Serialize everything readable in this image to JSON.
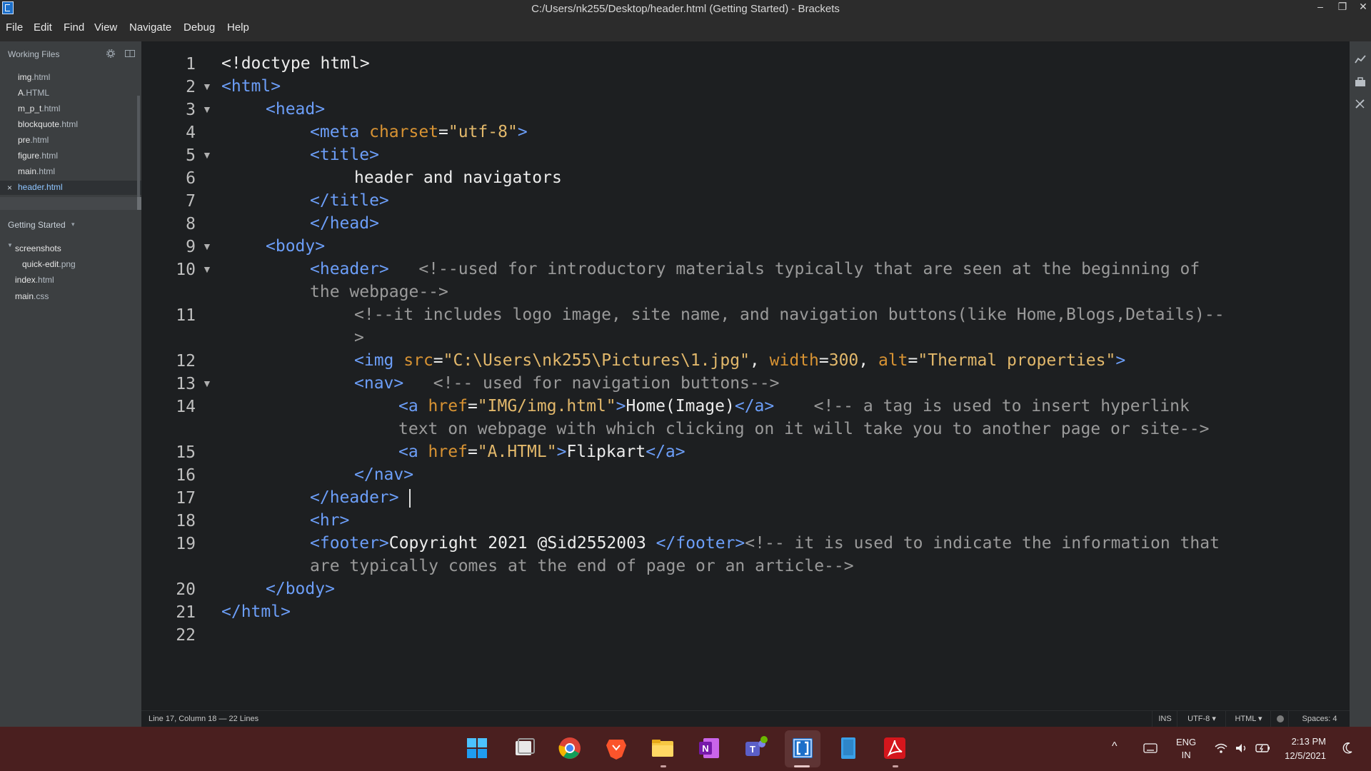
{
  "window": {
    "title": "C:/Users/nk255/Desktop/header.html (Getting Started) - Brackets",
    "minimize_glyph": "–",
    "restore_glyph": "❐",
    "close_glyph": "✕"
  },
  "menu": [
    "File",
    "Edit",
    "Find",
    "View",
    "Navigate",
    "Debug",
    "Help"
  ],
  "sidebar": {
    "working_files_title": "Working Files",
    "working_files": [
      {
        "name": "img",
        "ext": ".html"
      },
      {
        "name": "A",
        "ext": ".HTML"
      },
      {
        "name": "m_p_t",
        "ext": ".html"
      },
      {
        "name": "blockquote",
        "ext": ".html"
      },
      {
        "name": "pre",
        "ext": ".html"
      },
      {
        "name": "figure",
        "ext": ".html"
      },
      {
        "name": "main",
        "ext": ".html"
      },
      {
        "name": "header",
        "ext": ".html",
        "active": true
      }
    ],
    "close_glyph": "×",
    "project_title": "Getting Started",
    "project_caret": "▾",
    "tree": [
      {
        "name": "screenshots",
        "ext": "",
        "type": "folder"
      },
      {
        "name": "quick-edit",
        "ext": ".png",
        "type": "file"
      },
      {
        "name": "index",
        "ext": ".html",
        "type": "file"
      },
      {
        "name": "main",
        "ext": ".css",
        "type": "file"
      }
    ]
  },
  "editor": {
    "line_numbers": [
      "1",
      "2",
      "3",
      "4",
      "5",
      "6",
      "7",
      "8",
      "9",
      "10",
      "11",
      "12",
      "13",
      "14",
      "15",
      "16",
      "17",
      "18",
      "19",
      "20",
      "21",
      "22"
    ],
    "fold_marker": "▼",
    "lines": {
      "l1": {
        "tag1": "<!doctype html>"
      },
      "l2": {
        "tag1": "<html>"
      },
      "l3": {
        "tag1": "<head>"
      },
      "l4": {
        "tag1": "<meta ",
        "attr1": "charset",
        "eq": "=",
        "val1": "\"utf-8\"",
        "tag2": ">"
      },
      "l5": {
        "tag1": "<title>"
      },
      "l6": {
        "text": "header and navigators"
      },
      "l7": {
        "tag1": "</title>"
      },
      "l8": {
        "tag1": "</head>"
      },
      "l9": {
        "tag1": "<body>"
      },
      "l10": {
        "tag1": "<header>",
        "comment": "<!--used for introductory materials typically that are seen at the beginning of",
        "comment_cont": "the webpage-->"
      },
      "l11": {
        "comment": "<!--it includes logo image, site name, and navigation buttons(like Home,Blogs,Details)--",
        "comment_cont": ">"
      },
      "l12": {
        "tag1": "<img ",
        "attr1": "src",
        "eq1": "=",
        "val1": "\"C:\\Users\\nk255\\Pictures\\1.jpg\"",
        "sep1": ", ",
        "attr2": "width",
        "eq2": "=",
        "val2": "300",
        "sep2": ", ",
        "attr3": "alt",
        "eq3": "=",
        "val3": "\"Thermal properties\"",
        "tag2": ">"
      },
      "l13": {
        "tag1": "<nav>",
        "comment": "<!-- used for navigation buttons-->"
      },
      "l14": {
        "tag1": "<a ",
        "attr1": "href",
        "eq": "=",
        "val1": "\"IMG/img.html\"",
        "tag2": ">",
        "text": "Home(Image)",
        "tag3": "</a>",
        "comment": "<!-- a tag is used to insert hyperlink",
        "comment_cont": "text on webpage with which clicking on it will take you to another page or site-->"
      },
      "l15": {
        "tag1": "<a ",
        "attr1": "href",
        "eq": "=",
        "val1": "\"A.HTML\"",
        "tag2": ">",
        "text": "Flipkart",
        "tag3": "</a>"
      },
      "l16": {
        "tag1": "</nav>"
      },
      "l17": {
        "tag1": "</header>"
      },
      "l18": {
        "tag1": "<hr>"
      },
      "l19": {
        "tag1": "<footer>",
        "text": "Copyright 2021 @Sid2552003 ",
        "tag2": "</footer>",
        "comment": "<!-- it is used to indicate the information that",
        "comment_cont": "are typically comes at the end of page or an article-->"
      },
      "l20": {
        "tag1": "</body>"
      },
      "l21": {
        "tag1": "</html>"
      }
    }
  },
  "status": {
    "position": "Line 17, Column 18 — 22 Lines",
    "mode": "INS",
    "encoding": "UTF-8 ▾",
    "language": "HTML ▾",
    "spaces": "Spaces: 4"
  },
  "taskbar": {
    "apps": [
      "windows-start",
      "task-view",
      "chrome",
      "brave",
      "file-explorer",
      "onenote",
      "teams",
      "brackets",
      "files",
      "acrobat"
    ],
    "tray": {
      "chevron": "^",
      "lang_line1": "ENG",
      "lang_line2": "IN",
      "time": "2:13 PM",
      "date": "12/5/2021"
    }
  },
  "colors": {
    "tag": "#6c9ef8",
    "attr": "#d89333",
    "string": "#e2b86b",
    "comment": "#9a9a9a",
    "taskbar": "#4a1f1f",
    "sidebar": "#3c3f41"
  }
}
